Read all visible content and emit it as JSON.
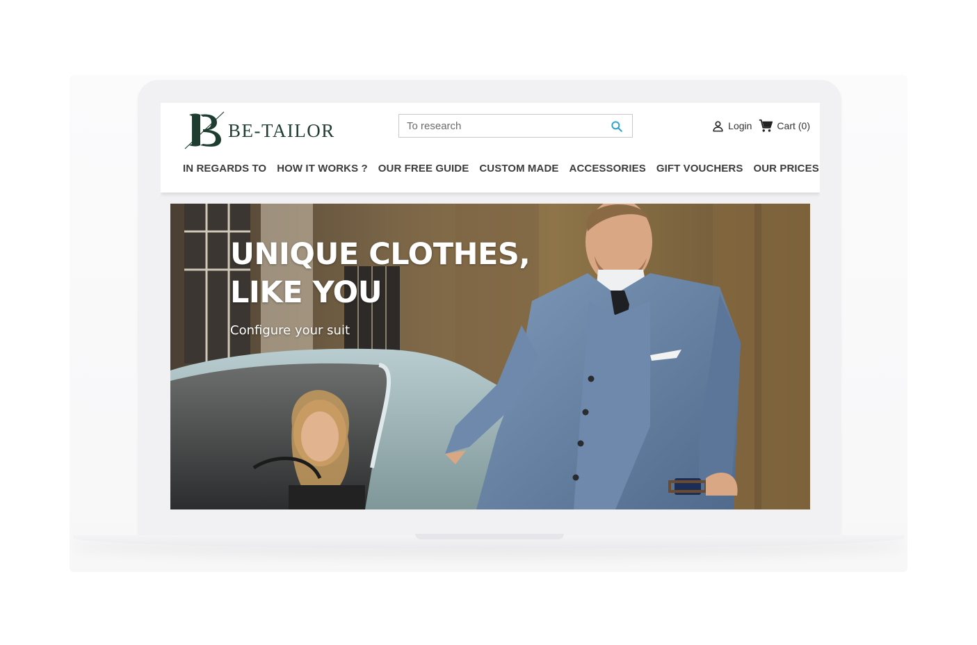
{
  "brand": {
    "logo_text": "BE-TAILOR",
    "logo_color": "#1e3d30"
  },
  "search": {
    "placeholder": "To research",
    "icon": "search-icon",
    "icon_color": "#2ea3c9"
  },
  "account": {
    "login_label": "Login",
    "login_icon": "user-icon"
  },
  "cart": {
    "label": "Cart",
    "count": "(0)",
    "icon": "cart-icon"
  },
  "nav": {
    "items": [
      {
        "label": "IN REGARDS TO"
      },
      {
        "label": "HOW IT WORKS ?"
      },
      {
        "label": "OUR FREE GUIDE"
      },
      {
        "label": "CUSTOM MADE"
      },
      {
        "label": "ACCESSORIES"
      },
      {
        "label": "GIFT VOUCHERS"
      },
      {
        "label": "OUR PRICES"
      }
    ]
  },
  "hero": {
    "title": "UNIQUE CLOTHES, LIKE YOU",
    "subtitle": "Configure your suit"
  }
}
